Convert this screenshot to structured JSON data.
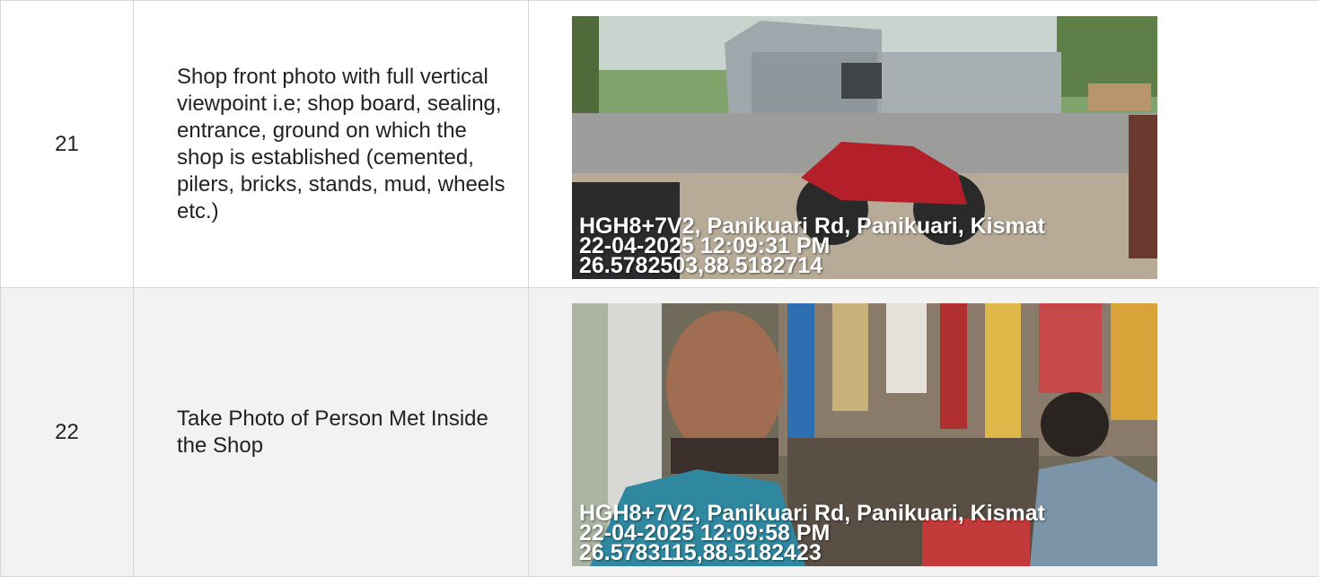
{
  "rows": [
    {
      "number": "21",
      "description": "Shop front photo with full vertical viewpoint i.e; shop board, sealing, entrance, ground on which the shop is established (cemented, pilers, bricks, stands, mud, wheels etc.)",
      "photo": {
        "address": "HGH8+7V2, Panikuari Rd, Panikuari, Kismat",
        "datetime": "22-04-2025 12:09:31 PM",
        "coordinates": "26.5782503,88.5182714"
      }
    },
    {
      "number": "22",
      "description": "Take Photo of Person Met Inside the Shop",
      "photo": {
        "address": "HGH8+7V2, Panikuari Rd, Panikuari, Kismat",
        "datetime": "22-04-2025 12:09:58 PM",
        "coordinates": "26.5783115,88.5182423"
      }
    }
  ]
}
